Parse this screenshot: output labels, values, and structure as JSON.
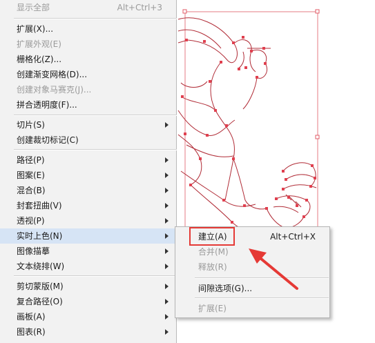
{
  "menu": {
    "items": [
      {
        "label": "显示全部",
        "shortcut": "Alt+Ctrl+3",
        "disabled": true,
        "submenu": false
      },
      {
        "label": "扩展(X)...",
        "shortcut": "",
        "disabled": false,
        "submenu": false
      },
      {
        "label": "扩展外观(E)",
        "shortcut": "",
        "disabled": true,
        "submenu": false
      },
      {
        "label": "栅格化(Z)...",
        "shortcut": "",
        "disabled": false,
        "submenu": false
      },
      {
        "label": "创建渐变网格(D)...",
        "shortcut": "",
        "disabled": false,
        "submenu": false
      },
      {
        "label": "创建对象马赛克(J)...",
        "shortcut": "",
        "disabled": true,
        "submenu": false
      },
      {
        "label": "拼合透明度(F)...",
        "shortcut": "",
        "disabled": false,
        "submenu": false
      },
      {
        "label": "切片(S)",
        "shortcut": "",
        "disabled": false,
        "submenu": true
      },
      {
        "label": "创建裁切标记(C)",
        "shortcut": "",
        "disabled": false,
        "submenu": false
      },
      {
        "label": "路径(P)",
        "shortcut": "",
        "disabled": false,
        "submenu": true
      },
      {
        "label": "图案(E)",
        "shortcut": "",
        "disabled": false,
        "submenu": true
      },
      {
        "label": "混合(B)",
        "shortcut": "",
        "disabled": false,
        "submenu": true
      },
      {
        "label": "封套扭曲(V)",
        "shortcut": "",
        "disabled": false,
        "submenu": true
      },
      {
        "label": "透视(P)",
        "shortcut": "",
        "disabled": false,
        "submenu": true
      },
      {
        "label": "实时上色(N)",
        "shortcut": "",
        "disabled": false,
        "submenu": true,
        "highlighted": true
      },
      {
        "label": "图像描摹",
        "shortcut": "",
        "disabled": false,
        "submenu": true
      },
      {
        "label": "文本绕排(W)",
        "shortcut": "",
        "disabled": false,
        "submenu": true
      },
      {
        "label": "剪切蒙版(M)",
        "shortcut": "",
        "disabled": false,
        "submenu": true
      },
      {
        "label": "复合路径(O)",
        "shortcut": "",
        "disabled": false,
        "submenu": true
      },
      {
        "label": "画板(A)",
        "shortcut": "",
        "disabled": false,
        "submenu": true
      },
      {
        "label": "图表(R)",
        "shortcut": "",
        "disabled": false,
        "submenu": true
      }
    ]
  },
  "submenu": {
    "items": [
      {
        "label": "建立(A)",
        "shortcut": "Alt+Ctrl+X",
        "disabled": false
      },
      {
        "label": "合并(M)",
        "shortcut": "",
        "disabled": true
      },
      {
        "label": "释放(R)",
        "shortcut": "",
        "disabled": true
      },
      {
        "label": "间隙选项(G)...",
        "shortcut": "",
        "disabled": false
      },
      {
        "label": "扩展(E)",
        "shortcut": "",
        "disabled": true
      }
    ]
  },
  "annotation": {
    "color": "#e53935"
  },
  "colors": {
    "path": "#c0303a",
    "anchor": "#e0404f",
    "menu_bg": "#f2f2f2",
    "highlight": "#d6e4f5"
  }
}
